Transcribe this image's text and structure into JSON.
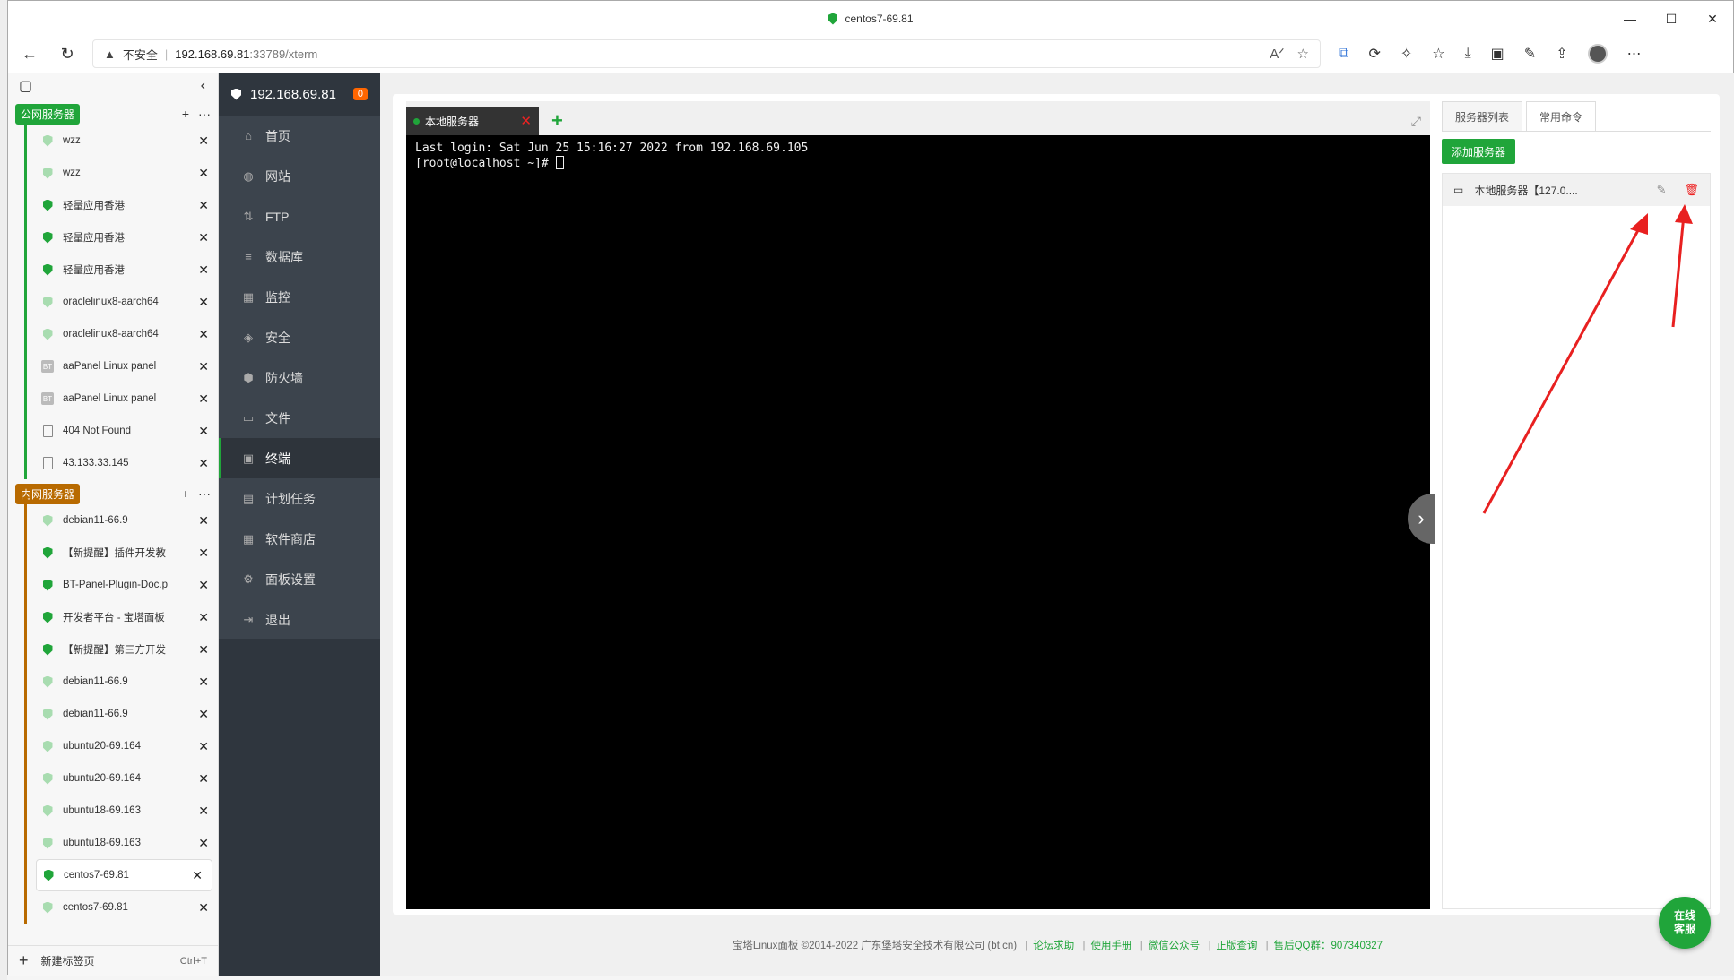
{
  "window": {
    "title": "centos7-69.81",
    "controls": [
      "—",
      "☐",
      "✕"
    ]
  },
  "address": {
    "security": "不安全",
    "host": "192.168.69.81",
    "path": ":33789/xterm"
  },
  "tabs_sidebar": {
    "groups": [
      {
        "name": "公网服务器",
        "color": "#20a53a",
        "items": [
          {
            "label": "wzz",
            "icon": "shield-light"
          },
          {
            "label": "wzz",
            "icon": "shield-light"
          },
          {
            "label": "轻量应用香港",
            "icon": "shield-dark"
          },
          {
            "label": "轻量应用香港",
            "icon": "shield-dark"
          },
          {
            "label": "轻量应用香港",
            "icon": "shield-dark"
          },
          {
            "label": "oraclelinux8-aarch64",
            "icon": "shield-light"
          },
          {
            "label": "oraclelinux8-aarch64",
            "icon": "shield-light"
          },
          {
            "label": "aaPanel Linux panel",
            "icon": "bt"
          },
          {
            "label": "aaPanel Linux panel",
            "icon": "bt"
          },
          {
            "label": "404 Not Found",
            "icon": "doc"
          },
          {
            "label": "43.133.33.145",
            "icon": "doc"
          }
        ]
      },
      {
        "name": "内网服务器",
        "color": "#b86a00",
        "items": [
          {
            "label": "debian11-66.9",
            "icon": "shield-light"
          },
          {
            "label": "【新提醒】插件开发教",
            "icon": "shield-dark"
          },
          {
            "label": "BT-Panel-Plugin-Doc.p",
            "icon": "shield-dark"
          },
          {
            "label": "开发者平台 - 宝塔面板",
            "icon": "shield-dark"
          },
          {
            "label": "【新提醒】第三方开发",
            "icon": "shield-dark"
          },
          {
            "label": "debian11-66.9",
            "icon": "shield-light"
          },
          {
            "label": "debian11-66.9",
            "icon": "shield-light"
          },
          {
            "label": "ubuntu20-69.164",
            "icon": "shield-light"
          },
          {
            "label": "ubuntu20-69.164",
            "icon": "shield-light"
          },
          {
            "label": "ubuntu18-69.163",
            "icon": "shield-light"
          },
          {
            "label": "ubuntu18-69.163",
            "icon": "shield-light"
          },
          {
            "label": "centos7-69.81",
            "icon": "shield-dark",
            "active": true
          },
          {
            "label": "centos7-69.81",
            "icon": "shield-light"
          }
        ]
      }
    ],
    "new_tab": {
      "label": "新建标签页",
      "shortcut": "Ctrl+T"
    }
  },
  "panel_nav": {
    "host": "192.168.69.81",
    "badge": "0",
    "items": [
      {
        "label": "首页",
        "icon": "⌂"
      },
      {
        "label": "网站",
        "icon": "◍"
      },
      {
        "label": "FTP",
        "icon": "⇅"
      },
      {
        "label": "数据库",
        "icon": "≡"
      },
      {
        "label": "监控",
        "icon": "▦"
      },
      {
        "label": "安全",
        "icon": "◈"
      },
      {
        "label": "防火墙",
        "icon": "⬢"
      },
      {
        "label": "文件",
        "icon": "▭"
      },
      {
        "label": "终端",
        "icon": "▣",
        "active": true
      },
      {
        "label": "计划任务",
        "icon": "▤"
      },
      {
        "label": "软件商店",
        "icon": "▦"
      },
      {
        "label": "面板设置",
        "icon": "⚙"
      },
      {
        "label": "退出",
        "icon": "⇥"
      }
    ]
  },
  "terminal": {
    "tab_label": "本地服务器",
    "lines": [
      "Last login: Sat Jun 25 15:16:27 2022 from 192.168.69.105",
      "[root@localhost ~]# "
    ]
  },
  "right_panel": {
    "tabs": [
      "服务器列表",
      "常用命令"
    ],
    "add_button": "添加服务器",
    "servers": [
      {
        "label": "本地服务器【127.0...."
      }
    ]
  },
  "footer": {
    "copyright": "宝塔Linux面板 ©2014-2022 广东堡塔安全技术有限公司 (bt.cn)",
    "links": [
      "论坛求助",
      "使用手册",
      "微信公众号",
      "正版查询"
    ],
    "qq": "售后QQ群：907340327"
  },
  "chat": {
    "line1": "在线",
    "line2": "客服"
  }
}
